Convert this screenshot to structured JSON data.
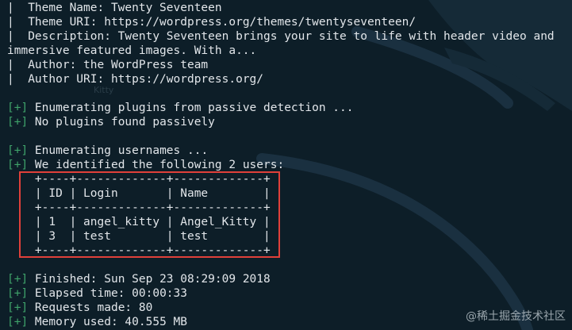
{
  "terminal": {
    "lines": [
      {
        "prefix": "|",
        "text": "  Theme Name: Twenty Seventeen"
      },
      {
        "prefix": "|",
        "text": "  Theme URI: https://wordpress.org/themes/twentyseventeen/"
      },
      {
        "prefix": "|",
        "text": "  Description: Twenty Seventeen brings your site to life with header video and"
      },
      {
        "prefix": "",
        "text": "immersive featured images. With a..."
      },
      {
        "prefix": "|",
        "text": "  Author: the WordPress team"
      },
      {
        "prefix": "|",
        "text": "  Author URI: https://wordpress.org/"
      },
      {
        "prefix": "",
        "text": ""
      },
      {
        "prefix": "[+]",
        "text": " Enumerating plugins from passive detection ..."
      },
      {
        "prefix": "[+]",
        "text": " No plugins found passively"
      },
      {
        "prefix": "",
        "text": ""
      },
      {
        "prefix": "[+]",
        "text": " Enumerating usernames ..."
      },
      {
        "prefix": "[+]",
        "text": " We identified the following 2 users:"
      },
      {
        "prefix": "",
        "text": "    +----+-------------+-------------+"
      },
      {
        "prefix": "",
        "text": "    | ID | Login       | Name        |"
      },
      {
        "prefix": "",
        "text": "    +----+-------------+-------------+"
      },
      {
        "prefix": "",
        "text": "    | 1  | angel_kitty | Angel_Kitty |"
      },
      {
        "prefix": "",
        "text": "    | 3  | test        | test        |"
      },
      {
        "prefix": "",
        "text": "    +----+-------------+-------------+"
      },
      {
        "prefix": "",
        "text": ""
      },
      {
        "prefix": "[+]",
        "text": " Finished: Sun Sep 23 08:29:09 2018"
      },
      {
        "prefix": "[+]",
        "text": " Elapsed time: 00:00:33"
      },
      {
        "prefix": "[+]",
        "text": " Requests made: 80"
      },
      {
        "prefix": "[+]",
        "text": " Memory used: 40.555 MB"
      }
    ]
  },
  "faint_label": "Kitty",
  "watermark": {
    "text": "@稀土掘金技术社区"
  },
  "colors": {
    "background": "#0d1e28",
    "text": "#e2e6ea",
    "plus": "#3fa26a",
    "highlight_box": "#e0403a"
  }
}
